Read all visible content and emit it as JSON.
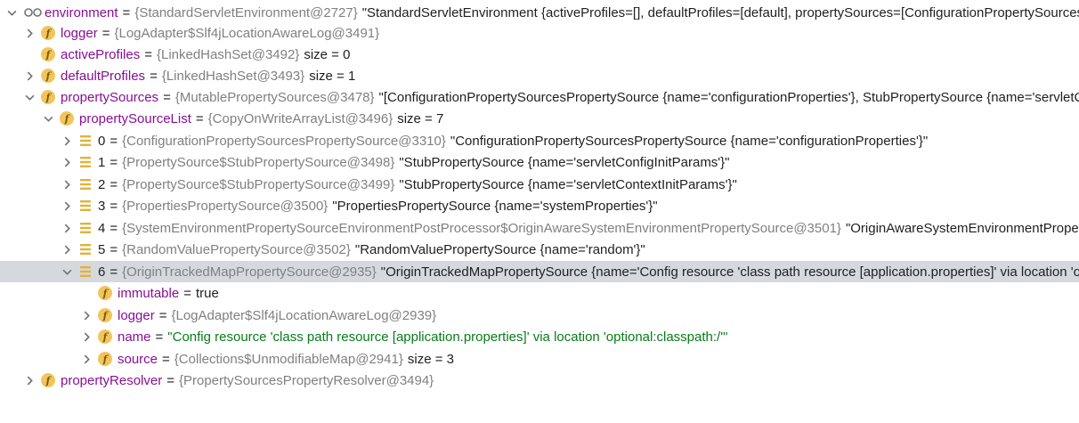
{
  "rows": [
    {
      "name": "environment",
      "ref": "{StandardServletEnvironment@2727}",
      "desc": "\"StandardServletEnvironment {activeProfiles=[], defaultProfiles=[default], propertySources=[ConfigurationPropertySourcesPropertySource {name='configurationProperties'}, StubPropertySource {name='servletConfigInitParams'}"
    },
    {
      "name": "logger",
      "ref": "{LogAdapter$Slf4jLocationAwareLog@3491}"
    },
    {
      "name": "activeProfiles",
      "ref": "{LinkedHashSet@3492}",
      "desc": "size = 0"
    },
    {
      "name": "defaultProfiles",
      "ref": "{LinkedHashSet@3493}",
      "desc": "size = 1"
    },
    {
      "name": "propertySources",
      "ref": "{MutablePropertySources@3478}",
      "desc": "\"[ConfigurationPropertySourcesPropertySource {name='configurationProperties'}, StubPropertySource {name='servletConfigInitParams'}"
    },
    {
      "name": "propertySourceList",
      "ref": "{CopyOnWriteArrayList@3496}",
      "desc": "size = 7"
    },
    {
      "name": "0",
      "ref": "{ConfigurationPropertySourcesPropertySource@3310}",
      "desc": "\"ConfigurationPropertySourcesPropertySource {name='configurationProperties'}\""
    },
    {
      "name": "1",
      "ref": "{PropertySource$StubPropertySource@3498}",
      "desc": "\"StubPropertySource {name='servletConfigInitParams'}\""
    },
    {
      "name": "2",
      "ref": "{PropertySource$StubPropertySource@3499}",
      "desc": "\"StubPropertySource {name='servletContextInitParams'}\""
    },
    {
      "name": "3",
      "ref": "{PropertiesPropertySource@3500}",
      "desc": "\"PropertiesPropertySource {name='systemProperties'}\""
    },
    {
      "name": "4",
      "ref": "{SystemEnvironmentPropertySourceEnvironmentPostProcessor$OriginAwareSystemEnvironmentPropertySource@3501}",
      "desc": "\"OriginAwareSystemEnvironmentPropertySource {name='systemEnvironment'}\""
    },
    {
      "name": "5",
      "ref": "{RandomValuePropertySource@3502}",
      "desc": "\"RandomValuePropertySource {name='random'}\""
    },
    {
      "name": "6",
      "ref": "{OriginTrackedMapPropertySource@2935}",
      "desc": "\"OriginTrackedMapPropertySource {name='Config resource 'class path resource [application.properties]' via location 'optional:classpath:/''}\""
    },
    {
      "name": "immutable",
      "value": "true"
    },
    {
      "name": "logger",
      "ref": "{LogAdapter$Slf4jLocationAwareLog@2939}"
    },
    {
      "name": "name",
      "value": "\"Config resource 'class path resource [application.properties]' via location 'optional:classpath:/'\""
    },
    {
      "name": "source",
      "ref": "{Collections$UnmodifiableMap@2941}",
      "desc": "size = 3"
    },
    {
      "name": "propertyResolver",
      "ref": "{PropertySourcesPropertyResolver@3494}"
    }
  ],
  "colors": {
    "name": "#871094",
    "ref": "#808080",
    "string": "#067d17",
    "selected": "#d5d9de",
    "field_icon": "#f2c55c",
    "list_icon": "#e0b33b"
  },
  "icons": {
    "watch": "watch-glasses-icon",
    "field": "field-icon",
    "list": "list-item-icon",
    "expand": "chevron-right-icon",
    "collapse": "chevron-down-icon"
  }
}
